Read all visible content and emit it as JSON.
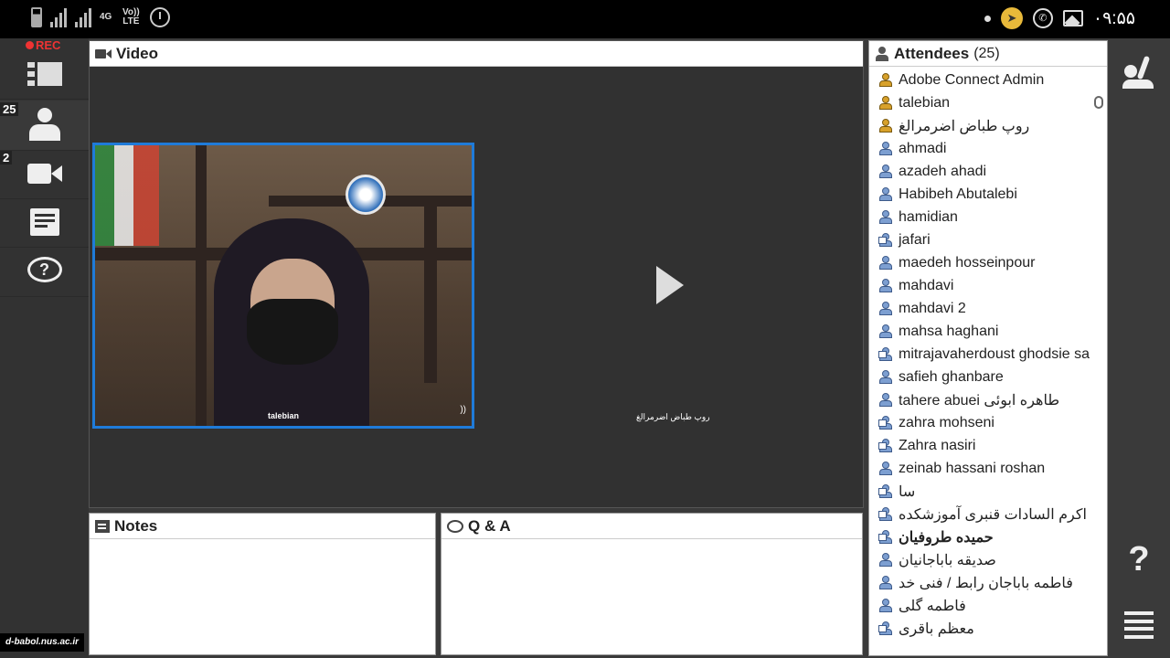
{
  "status_bar": {
    "network": "4G",
    "volte": "Vo)) LTE",
    "time": "۰۹:۵۵"
  },
  "sidebar": {
    "rec_label": "REC",
    "items": [
      {
        "name": "layouts",
        "badge": ""
      },
      {
        "name": "attendees",
        "badge": "25"
      },
      {
        "name": "video",
        "badge": "2"
      },
      {
        "name": "notes",
        "badge": ""
      },
      {
        "name": "qa",
        "badge": ""
      }
    ]
  },
  "video_pod": {
    "title": "Video",
    "feeds": [
      {
        "name": "talebian"
      },
      {
        "name": "روپ طباض اضرمرالغ"
      }
    ]
  },
  "notes_pod": {
    "title": "Notes"
  },
  "qa_pod": {
    "title": "Q & A"
  },
  "attendees_pod": {
    "title": "Attendees",
    "count": "(25)",
    "attendees": [
      {
        "name": "Adobe Connect Admin",
        "role": "host",
        "bold": false,
        "mic": false
      },
      {
        "name": "talebian",
        "role": "host",
        "bold": false,
        "mic": true
      },
      {
        "name": "روپ طباض اضرمرالغ",
        "role": "host",
        "bold": false,
        "mic": false
      },
      {
        "name": "ahmadi",
        "role": "participant",
        "bold": false,
        "mic": false
      },
      {
        "name": "azadeh  ahadi",
        "role": "participant",
        "bold": false,
        "mic": false
      },
      {
        "name": "Habibeh Abutalebi",
        "role": "participant",
        "bold": false,
        "mic": false
      },
      {
        "name": "hamidian",
        "role": "participant",
        "bold": false,
        "mic": false
      },
      {
        "name": "jafari",
        "role": "presenter",
        "bold": false,
        "mic": false
      },
      {
        "name": "maedeh hosseinpour",
        "role": "participant",
        "bold": false,
        "mic": false
      },
      {
        "name": "mahdavi",
        "role": "participant",
        "bold": false,
        "mic": false
      },
      {
        "name": "mahdavi 2",
        "role": "participant",
        "bold": false,
        "mic": false
      },
      {
        "name": "mahsa haghani",
        "role": "participant",
        "bold": false,
        "mic": false
      },
      {
        "name": "mitrajavaherdoust ghodsie sa",
        "role": "presenter",
        "bold": false,
        "mic": false
      },
      {
        "name": "safieh  ghanbare",
        "role": "participant",
        "bold": false,
        "mic": false
      },
      {
        "name": "tahere  abuei  طاهره ابوئی",
        "role": "participant",
        "bold": false,
        "mic": false
      },
      {
        "name": "zahra mohseni",
        "role": "presenter",
        "bold": false,
        "mic": false
      },
      {
        "name": "Zahra nasiri",
        "role": "presenter",
        "bold": false,
        "mic": false
      },
      {
        "name": "zeinab hassani roshan",
        "role": "participant",
        "bold": false,
        "mic": false
      },
      {
        "name": "سا",
        "role": "presenter",
        "bold": false,
        "mic": false
      },
      {
        "name": "اکرم السادات قنبری آموزشکده",
        "role": "presenter",
        "bold": false,
        "mic": false
      },
      {
        "name": "حمیده طروفیان",
        "role": "presenter",
        "bold": true,
        "mic": false
      },
      {
        "name": "صدیقه باباجانیان",
        "role": "participant",
        "bold": false,
        "mic": false
      },
      {
        "name": "فاطمه باباجان رابط / فنی خد",
        "role": "participant",
        "bold": false,
        "mic": false
      },
      {
        "name": "فاطمه گلی",
        "role": "participant",
        "bold": false,
        "mic": false
      },
      {
        "name": "معظم باقری",
        "role": "presenter",
        "bold": false,
        "mic": false
      }
    ]
  },
  "right_rail": {
    "help_label": "?",
    "items": [
      "raise-hand",
      "help",
      "menu"
    ]
  },
  "watermark": "d-babol.nus.ac.ir"
}
